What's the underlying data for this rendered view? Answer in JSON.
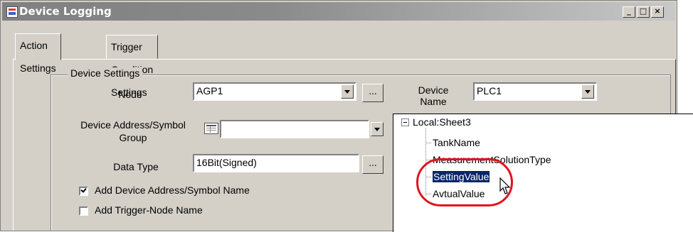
{
  "window": {
    "title": "Device Logging",
    "minimize": "_",
    "maximize": "□",
    "close": "×"
  },
  "tabs": [
    {
      "label": "Action Settings",
      "active": true
    },
    {
      "label": "Trigger Condition Settings",
      "active": false
    }
  ],
  "device_settings": {
    "group_label": "Device Settings",
    "node_label": "Node",
    "node_value": "AGP1",
    "browse_label": "...",
    "device_name_label_line1": "Device",
    "device_name_label_line2": "Name",
    "device_name_value": "PLC1",
    "address_label_line1": "Device Address/Symbol",
    "address_label_line2": "Group",
    "address_value": "",
    "data_type_label": "Data Type",
    "data_type_value": "16Bit(Signed)",
    "add_address_label": "Add Device Address/Symbol Name",
    "add_address_checked": true,
    "add_trigger_label": "Add Trigger-Node Name",
    "add_trigger_checked": false
  },
  "tree": {
    "root": "Local:Sheet3",
    "children": [
      "TankName",
      "MeasurementSolutionType",
      "SettingValue",
      "AvtualValue"
    ],
    "selected": "SettingValue"
  },
  "colors": {
    "selection": "#0a246a",
    "highlight_ring": "#e0141e"
  }
}
